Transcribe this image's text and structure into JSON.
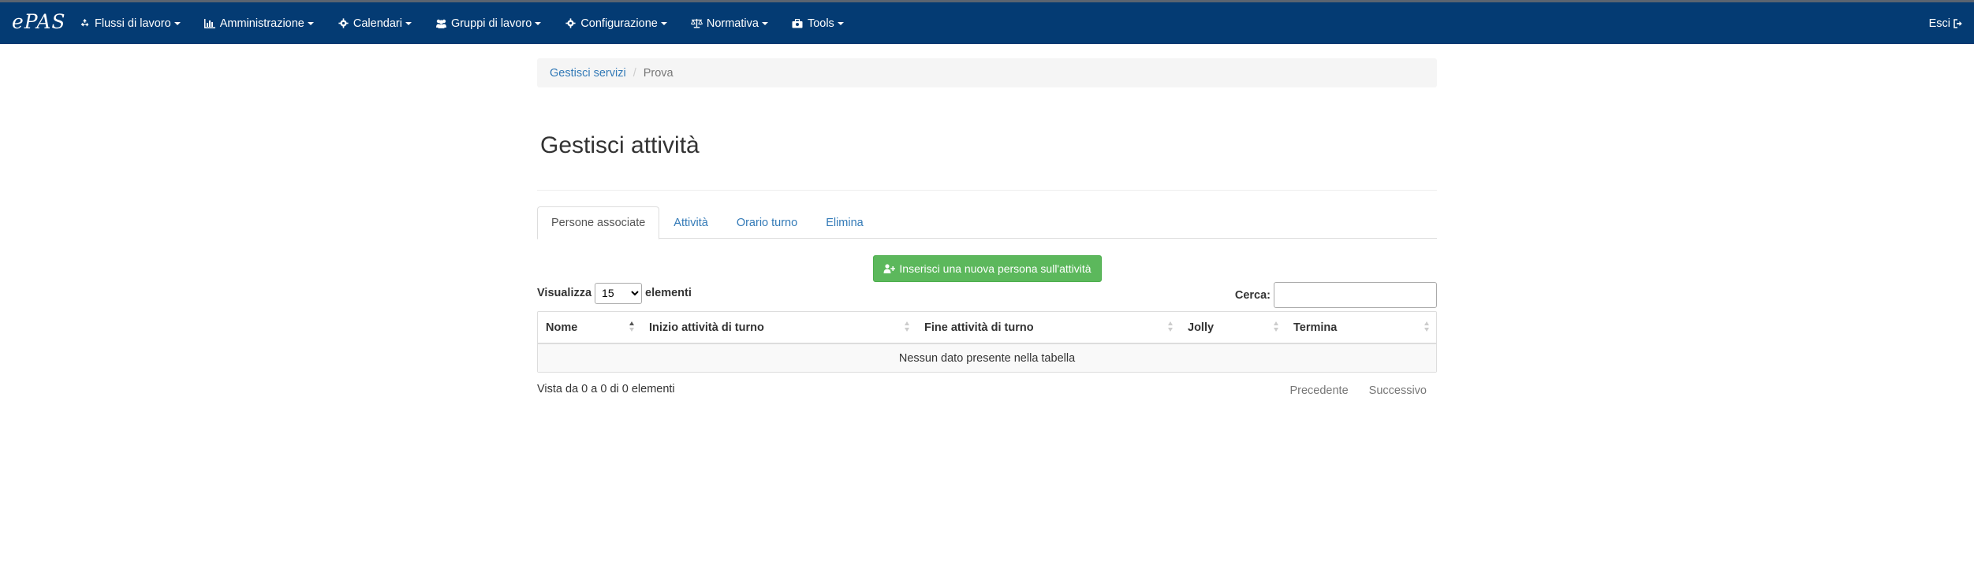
{
  "app": {
    "brand": "ePAS"
  },
  "nav": {
    "items": [
      {
        "label": "Flussi di lavoro",
        "icon": "recycle-icon"
      },
      {
        "label": "Amministrazione",
        "icon": "bar-chart-icon"
      },
      {
        "label": "Calendari",
        "icon": "gear-icon"
      },
      {
        "label": "Gruppi di lavoro",
        "icon": "users-icon"
      },
      {
        "label": "Configurazione",
        "icon": "gear-icon"
      },
      {
        "label": "Normativa",
        "icon": "balance-scale-icon"
      },
      {
        "label": "Tools",
        "icon": "briefcase-icon"
      }
    ],
    "logout_label": "Esci"
  },
  "breadcrumb": {
    "items": [
      "Gestisci servizi",
      "Prova"
    ]
  },
  "page": {
    "title": "Gestisci attività"
  },
  "tabs": [
    {
      "label": "Persone associate",
      "active": true
    },
    {
      "label": "Attività",
      "active": false
    },
    {
      "label": "Orario turno",
      "active": false
    },
    {
      "label": "Elimina",
      "active": false
    }
  ],
  "actions": {
    "add_person_label": "Inserisci una nuova persona sull'attività"
  },
  "table_controls": {
    "length_prefix": "Visualizza",
    "length_selected": "15",
    "length_suffix": "elementi",
    "search_label": "Cerca:",
    "search_value": ""
  },
  "table": {
    "columns": [
      "Nome",
      "Inizio attività di turno",
      "Fine attività di turno",
      "Jolly",
      "Termina"
    ],
    "empty_message": "Nessun dato presente nella tabella",
    "info": "Vista da 0 a 0 di 0 elementi",
    "prev_label": "Precedente",
    "next_label": "Successivo"
  },
  "colors": {
    "navbar": "#043b73",
    "link": "#337ab7",
    "success": "#5cb85c"
  }
}
